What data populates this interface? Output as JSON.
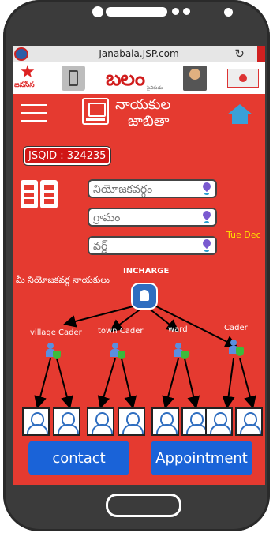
{
  "browser": {
    "url": "Janabala.JSP.com",
    "reload_glyph": "↻"
  },
  "banner": {
    "logo_text": "జనసేన",
    "title": "బలం",
    "title_sub": "సైనికుడు"
  },
  "header": {
    "title_line1": "నాయకుల",
    "title_line2": "జాబితా"
  },
  "jsqid": "JSQID : 324235",
  "form": {
    "constituency_placeholder": "నియోజకవర్గం",
    "village_placeholder": "గ్రామం",
    "ward_placeholder": "వర్డ్"
  },
  "date_text": "Tue Dec",
  "tree": {
    "incharge_label": "INCHARGE",
    "leaders_label": "మీ నియోజకవర్గ నాయకులు",
    "levels": [
      "village Cader",
      "town Cader",
      "ward",
      "Cader"
    ]
  },
  "buttons": {
    "contact": "contact",
    "appointment": "Appointment"
  },
  "colors": {
    "background": "#e53a30",
    "button": "#1a63d8",
    "date": "#ffe000",
    "accent_icon": "#3aa0d8"
  }
}
